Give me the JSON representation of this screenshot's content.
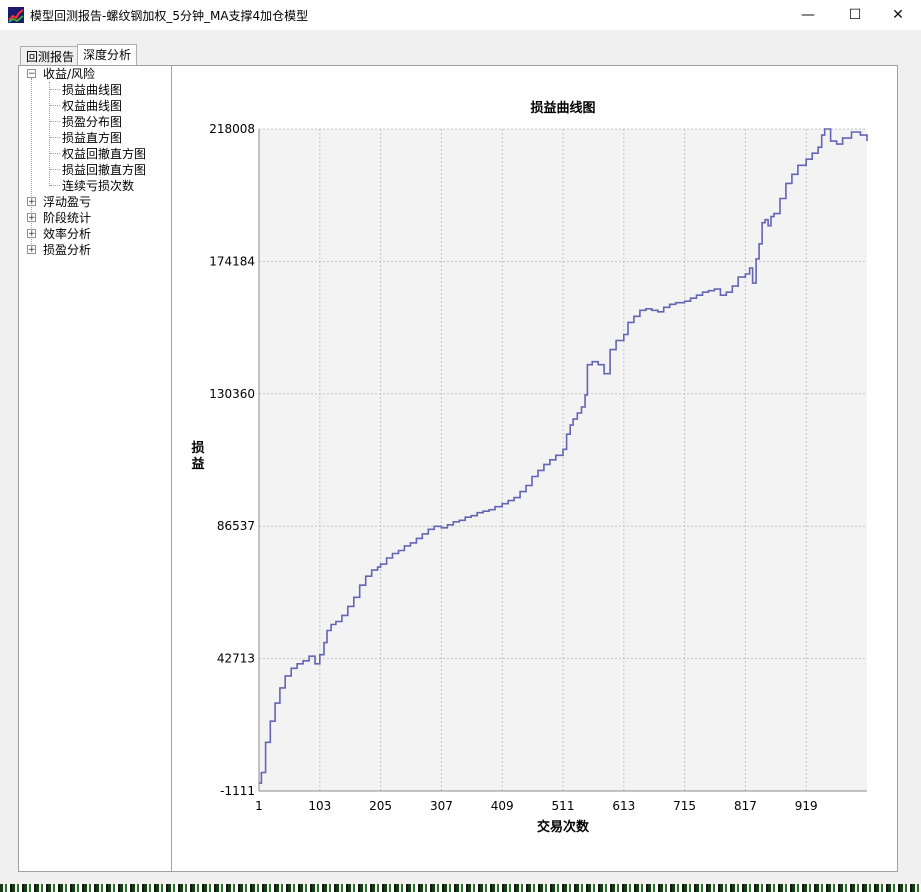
{
  "window": {
    "title": "模型回测报告-螺纹钢加权_5分钟_MA支撑4加仓模型",
    "controls": {
      "minimize": "—",
      "maximize": "☐",
      "close": "✕"
    }
  },
  "tabs": [
    {
      "label": "回测报告",
      "active": false
    },
    {
      "label": "深度分析",
      "active": true
    }
  ],
  "tree": {
    "groups": [
      {
        "label": "收益/风险",
        "expanded": true,
        "children": [
          "损益曲线图",
          "权益曲线图",
          "损盈分布图",
          "损益直方图",
          "权益回撤直方图",
          "损益回撤直方图",
          "连续亏损次数"
        ]
      },
      {
        "label": "浮动盈亏",
        "expanded": false,
        "children": []
      },
      {
        "label": "阶段统计",
        "expanded": false,
        "children": []
      },
      {
        "label": "效率分析",
        "expanded": false,
        "children": []
      },
      {
        "label": "损盈分析",
        "expanded": false,
        "children": []
      }
    ]
  },
  "chart_data": {
    "type": "line",
    "title": "损益曲线图",
    "xlabel": "交易次数",
    "ylabel": "损益",
    "x_ticks": [
      1,
      103,
      205,
      307,
      409,
      511,
      613,
      715,
      817,
      919
    ],
    "y_ticks": [
      -1111,
      42713,
      86537,
      130360,
      174184,
      218008
    ],
    "xlim": [
      1,
      1021
    ],
    "ylim": [
      -1111,
      218008
    ],
    "grid": true,
    "line_color": "#6464b4",
    "plot_bg": "#f3f3f3",
    "series": [
      {
        "x": [
          1,
          5,
          12,
          20,
          28,
          36,
          45,
          55,
          65,
          75,
          85,
          95,
          103,
          110,
          115,
          122,
          130,
          140,
          150,
          160,
          170,
          180,
          190,
          200,
          205,
          215,
          225,
          235,
          245,
          255,
          265,
          275,
          285,
          295,
          307,
          317,
          327,
          337,
          347,
          357,
          367,
          377,
          387,
          397,
          409,
          419,
          429,
          439,
          449,
          459,
          469,
          479,
          489,
          499,
          511,
          517,
          523,
          528,
          535,
          542,
          548,
          552,
          560,
          570,
          580,
          590,
          600,
          613,
          620,
          630,
          640,
          650,
          660,
          670,
          680,
          690,
          700,
          715,
          725,
          735,
          745,
          755,
          765,
          775,
          785,
          795,
          805,
          817,
          824,
          829,
          835,
          840,
          845,
          850,
          855,
          860,
          865,
          875,
          885,
          895,
          905,
          919,
          929,
          939,
          945,
          950,
          960,
          970,
          980,
          995,
          1010,
          1021
        ],
        "y": [
          1500,
          5000,
          15000,
          22000,
          28000,
          33000,
          37000,
          39500,
          41000,
          42000,
          43500,
          41000,
          44000,
          48000,
          52000,
          54000,
          55000,
          57000,
          60000,
          63000,
          67000,
          70000,
          72000,
          73000,
          74000,
          76000,
          77500,
          78500,
          80000,
          81000,
          82500,
          84000,
          85500,
          86500,
          86000,
          87000,
          88000,
          88500,
          89500,
          90000,
          91000,
          91500,
          92000,
          93000,
          94000,
          95000,
          96000,
          98000,
          100000,
          103000,
          105000,
          107000,
          108500,
          110000,
          112000,
          117000,
          120000,
          122000,
          124000,
          126000,
          130000,
          140000,
          141000,
          140000,
          137000,
          145000,
          148000,
          150000,
          154000,
          156000,
          158000,
          158500,
          158000,
          157500,
          159000,
          160000,
          160500,
          161000,
          162000,
          163000,
          164000,
          164500,
          165000,
          163000,
          164000,
          166000,
          169000,
          170000,
          172000,
          167000,
          175000,
          180000,
          187000,
          188000,
          186000,
          189000,
          190000,
          195000,
          200000,
          203000,
          206000,
          208000,
          210000,
          212000,
          216000,
          218000,
          214000,
          213000,
          215000,
          217000,
          216000,
          214000
        ]
      }
    ]
  }
}
